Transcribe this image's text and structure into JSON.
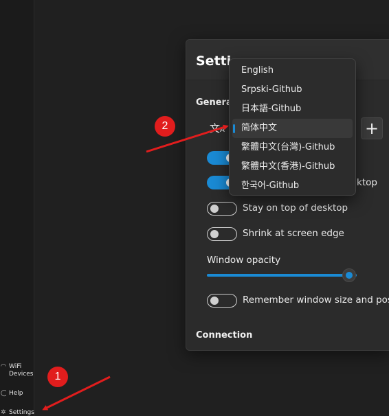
{
  "sidebar": {
    "items": [
      {
        "label": "WiFi\nDevices",
        "line1": "WiFi",
        "line2": "Devices",
        "icon": "wifi-icon"
      },
      {
        "label": "Help",
        "icon": "help-icon"
      },
      {
        "label": "Settings",
        "icon": "gear-icon"
      }
    ]
  },
  "settings": {
    "title": "Settings",
    "title_visible": "Setti",
    "sections": {
      "general": "General",
      "general_visible": "Genera",
      "connection": "Connection"
    },
    "language_icon": "translate-icon",
    "add_button": "+",
    "toggles": [
      {
        "label": "",
        "on": true
      },
      {
        "label": "ktop",
        "on": true
      },
      {
        "label": "Stay on top of desktop",
        "on": false
      },
      {
        "label": "Shrink at screen edge",
        "on": false
      },
      {
        "label": "Remember window size and positi",
        "on": false
      }
    ],
    "opacity": {
      "label": "Window opacity",
      "value_fraction": 0.95
    }
  },
  "language_dropdown": {
    "options": [
      "English",
      "Srpski-Github",
      "日本語-Github",
      "简体中文",
      "繁體中文(台灣)-Github",
      "繁體中文(香港)-Github",
      "한국어-Github"
    ],
    "selected_index": 3
  },
  "annotations": {
    "badge_1": "1",
    "badge_2": "2",
    "color": "#e11d1d"
  },
  "colors": {
    "accent": "#1a8ad4",
    "background": "#202020",
    "panel": "#2b2b2b"
  }
}
